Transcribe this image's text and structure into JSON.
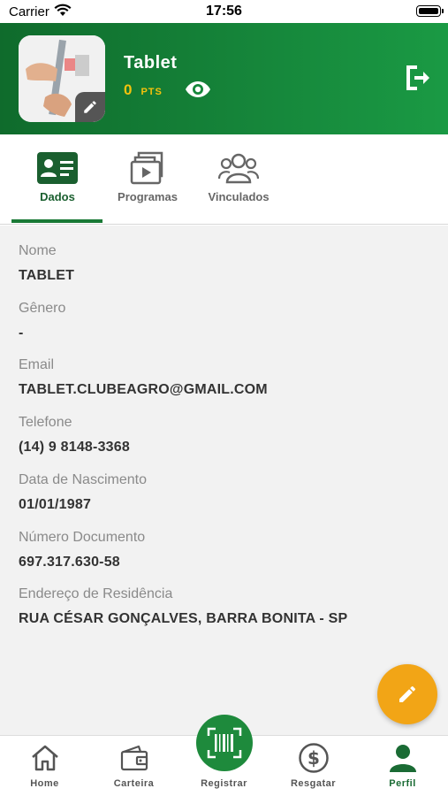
{
  "status_bar": {
    "carrier": "Carrier",
    "time": "17:56"
  },
  "header": {
    "user_name": "Tablet",
    "points_value": "0",
    "points_unit": "PTS",
    "colors": {
      "primary": "#16873b",
      "points": "#f4c20d"
    }
  },
  "tabs": [
    {
      "label": "Dados",
      "icon": "id-card-icon",
      "active": true
    },
    {
      "label": "Programas",
      "icon": "play-folder-icon",
      "active": false
    },
    {
      "label": "Vinculados",
      "icon": "people-icon",
      "active": false
    }
  ],
  "profile": {
    "fields": [
      {
        "label": "Nome",
        "value": "TABLET"
      },
      {
        "label": "Gênero",
        "value": "-"
      },
      {
        "label": "Email",
        "value": "TABLET.CLUBEAGRO@GMAIL.COM"
      },
      {
        "label": "Telefone",
        "value": "(14) 9 8148-3368"
      },
      {
        "label": "Data de Nascimento",
        "value": "01/01/1987"
      },
      {
        "label": "Número Documento",
        "value": "697.317.630-58"
      },
      {
        "label": "Endereço de Residência",
        "value": "RUA CÉSAR GONÇALVES, BARRA BONITA - SP"
      }
    ]
  },
  "fab": {
    "icon": "pencil-icon",
    "color": "#f2a516"
  },
  "bottom_nav": [
    {
      "label": "Home",
      "icon": "home-icon",
      "active": false
    },
    {
      "label": "Carteira",
      "icon": "wallet-icon",
      "active": false
    },
    {
      "label": "Registrar",
      "icon": "barcode-scan-icon",
      "active": false
    },
    {
      "label": "Resgatar",
      "icon": "dollar-circle-icon",
      "active": false
    },
    {
      "label": "Perfil",
      "icon": "person-icon",
      "active": true
    }
  ]
}
